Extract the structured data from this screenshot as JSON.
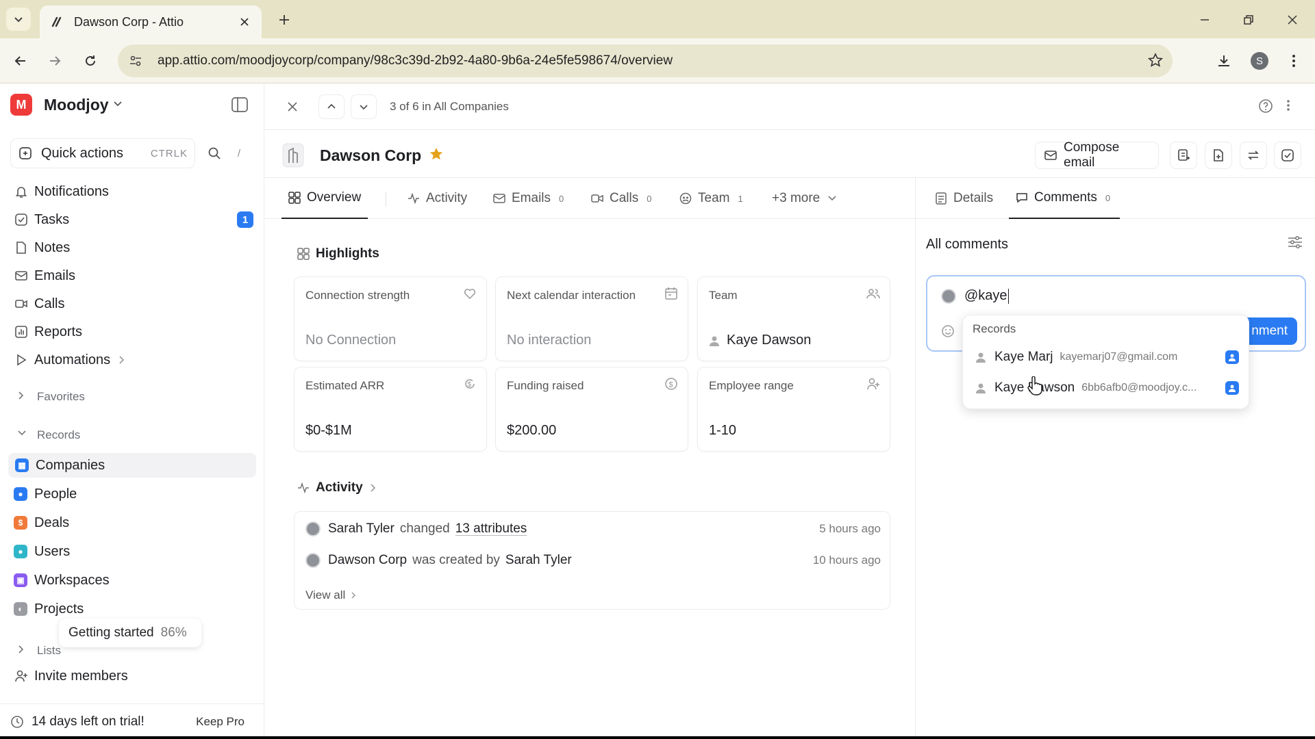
{
  "browser": {
    "tab_title": "Dawson Corp - Attio",
    "url": "app.attio.com/moodjoycorp/company/98c3c39d-2b92-4a80-9b6a-24e5fe598674/overview",
    "profile_initial": "S"
  },
  "workspace": {
    "name": "Moodjoy",
    "logo_letter": "M"
  },
  "sidebar": {
    "quick_actions_label": "Quick actions",
    "quick_actions_shortcut": "CTRLK",
    "slash_key": "/",
    "nav": {
      "notifications": "Notifications",
      "tasks": "Tasks",
      "tasks_badge": "1",
      "notes": "Notes",
      "emails": "Emails",
      "calls": "Calls",
      "reports": "Reports",
      "automations": "Automations"
    },
    "favorites_label": "Favorites",
    "records_label": "Records",
    "records": {
      "companies": "Companies",
      "people": "People",
      "deals": "Deals",
      "users": "Users",
      "workspaces": "Workspaces",
      "projects": "Projects"
    },
    "getting_started_label": "Getting started",
    "getting_started_percent": "86%",
    "lists_label": "Lists",
    "invite_label": "Invite members",
    "trial_label": "14 days left on trial!",
    "keep_pro_label": "Keep Pro"
  },
  "record": {
    "position_text": "3 of 6 in All Companies",
    "company_name": "Dawson Corp",
    "compose_label": "Compose email",
    "tabs": {
      "overview": "Overview",
      "activity": "Activity",
      "emails": "Emails",
      "emails_count": "0",
      "calls": "Calls",
      "calls_count": "0",
      "team": "Team",
      "team_count": "1",
      "more": "+3 more"
    },
    "right_tabs": {
      "details": "Details",
      "comments": "Comments",
      "comments_count": "0"
    }
  },
  "highlights": {
    "title": "Highlights",
    "cards": {
      "connection": {
        "label": "Connection strength",
        "value": "No Connection"
      },
      "next_calendar": {
        "label": "Next calendar interaction",
        "value": "No interaction"
      },
      "team": {
        "label": "Team",
        "value": "Kaye Dawson"
      },
      "arr": {
        "label": "Estimated ARR",
        "value": "$0-$1M"
      },
      "funding": {
        "label": "Funding raised",
        "value": "$200.00"
      },
      "employees": {
        "label": "Employee range",
        "value": "1-10"
      }
    }
  },
  "activity": {
    "title": "Activity",
    "row1": {
      "actor": "Sarah Tyler",
      "verb": "changed",
      "object": "13 attributes",
      "time": "5 hours ago"
    },
    "row2": {
      "subject": "Dawson Corp",
      "verb": "was created by",
      "actor": "Sarah Tyler",
      "time": "10 hours ago"
    },
    "view_all": "View all"
  },
  "comments": {
    "title": "All comments",
    "input_value": "@kaye",
    "submit_visible_text": "nment",
    "popup_title": "Records",
    "mentions": [
      {
        "name": "Kaye Marj",
        "email": "kayemarj07@gmail.com"
      },
      {
        "name": "Kaye Dawson",
        "email": "6bb6afb0@moodjoy.c..."
      }
    ]
  },
  "colors": {
    "accent": "#2a7bf2",
    "star": "#e3a21a",
    "logo": "#ef3a3a",
    "tabbar": "#e7e3c6"
  }
}
